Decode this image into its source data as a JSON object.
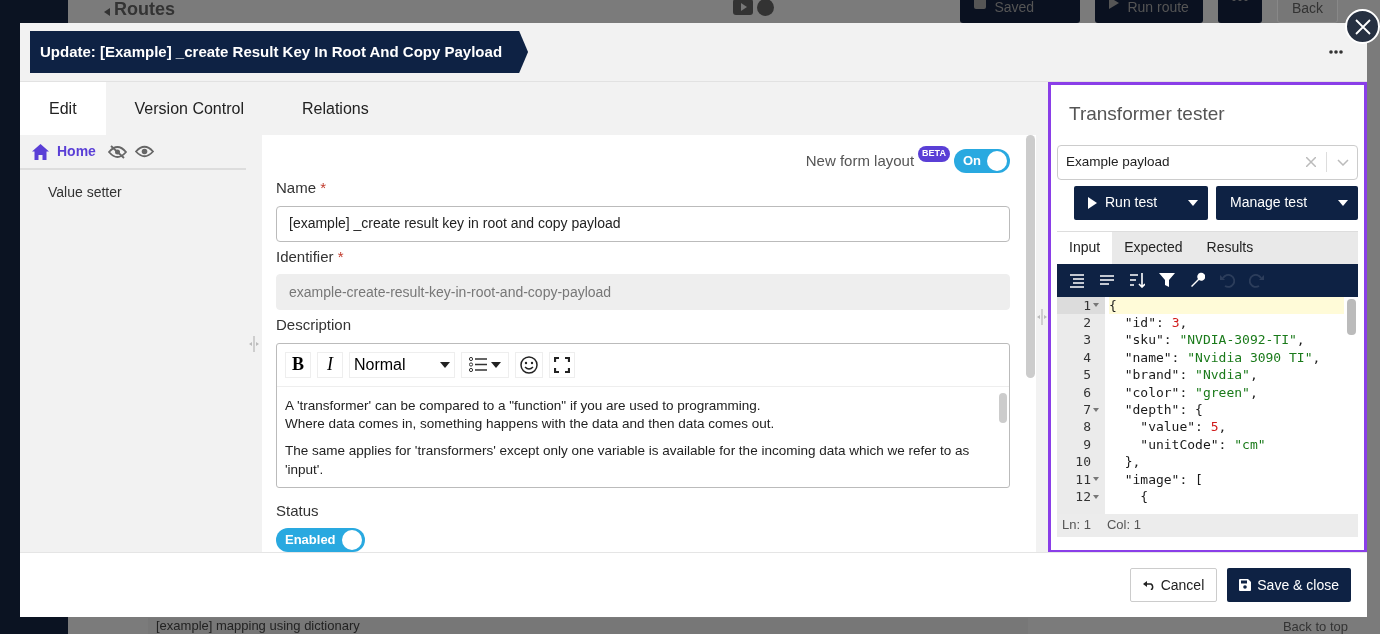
{
  "background": {
    "breadcrumb": "Routes",
    "buttons": [
      {
        "kind": "save",
        "label": "Saved"
      },
      {
        "kind": "run",
        "label": "Run route"
      },
      {
        "kind": "more"
      },
      {
        "kind": "back",
        "label": "Back"
      }
    ],
    "bottom_field": "[example] mapping using dictionary",
    "back_to_top": "Back to top"
  },
  "modal": {
    "title": "Update: [Example] _create Result Key In Root And Copy Payload",
    "tabs": [
      {
        "label": "Edit",
        "selected": true
      },
      {
        "label": "Version Control",
        "selected": false
      },
      {
        "label": "Relations",
        "selected": false
      }
    ],
    "sidebar": {
      "home": "Home",
      "items": [
        {
          "label": "Value setter"
        }
      ]
    },
    "form": {
      "layout_switch": {
        "label": "New form layout",
        "badge": "BETA",
        "state_label": "On",
        "on": true
      },
      "fields": [
        {
          "kind": "text",
          "label": "Name",
          "required_mark": "*",
          "value": "[example] _create result key in root and copy payload",
          "disabled": false
        },
        {
          "kind": "text",
          "label": "Identifier",
          "required_mark": "*",
          "value": "example-create-result-key-in-root-and-copy-payload",
          "disabled": true
        }
      ],
      "description": {
        "label": "Description",
        "toolbar": [
          {
            "kind": "bold",
            "glyph": "B"
          },
          {
            "kind": "italic",
            "glyph": "I"
          },
          {
            "kind": "select",
            "label": "Normal"
          },
          {
            "kind": "list"
          },
          {
            "kind": "emoji"
          },
          {
            "kind": "fullscreen"
          }
        ],
        "paragraphs": [
          [
            "A 'transformer' can be compared to a \"function\" if you are used to programming.",
            "Where data comes in, something happens with the data and then data comes out."
          ],
          [
            "The same applies for 'transformers' except only one variable is available for the incoming data which we refer to as 'input'."
          ]
        ]
      },
      "status": {
        "label": "Status",
        "state_label": "Enabled",
        "on": true
      }
    },
    "tester": {
      "title": "Transformer tester",
      "payload_select": "Example payload",
      "buttons": [
        {
          "label": "Run test",
          "kind": "run"
        },
        {
          "label": "Manage test",
          "kind": "menu"
        }
      ],
      "tabs": [
        {
          "label": "Input",
          "selected": true
        },
        {
          "label": "Expected",
          "selected": false
        },
        {
          "label": "Results",
          "selected": false
        }
      ],
      "toolbar": [
        {
          "kind": "format",
          "disabled": false
        },
        {
          "kind": "compact",
          "disabled": false
        },
        {
          "kind": "sort",
          "disabled": false
        },
        {
          "kind": "filter",
          "disabled": false
        },
        {
          "kind": "repair",
          "disabled": false
        },
        {
          "kind": "undo",
          "disabled": true
        },
        {
          "kind": "redo",
          "disabled": true
        }
      ],
      "lines": [
        {
          "number": "1",
          "foldable": true,
          "current": true,
          "tokens": [
            {
              "kind": "punct",
              "text": "{"
            }
          ]
        },
        {
          "number": "2",
          "foldable": false,
          "current": false,
          "tokens": [
            {
              "kind": "key",
              "text": "  \"id\": "
            },
            {
              "kind": "number",
              "text": "3"
            },
            {
              "kind": "punct",
              "text": ","
            }
          ]
        },
        {
          "number": "3",
          "foldable": false,
          "current": false,
          "tokens": [
            {
              "kind": "key",
              "text": "  \"sku\": "
            },
            {
              "kind": "string",
              "text": "\"NVDIA-3092-TI\""
            },
            {
              "kind": "punct",
              "text": ","
            }
          ]
        },
        {
          "number": "4",
          "foldable": false,
          "current": false,
          "tokens": [
            {
              "kind": "key",
              "text": "  \"name\": "
            },
            {
              "kind": "string",
              "text": "\"Nvidia 3090 TI\""
            },
            {
              "kind": "punct",
              "text": ","
            }
          ]
        },
        {
          "number": "5",
          "foldable": false,
          "current": false,
          "tokens": [
            {
              "kind": "key",
              "text": "  \"brand\": "
            },
            {
              "kind": "string",
              "text": "\"Nvdia\""
            },
            {
              "kind": "punct",
              "text": ","
            }
          ]
        },
        {
          "number": "6",
          "foldable": false,
          "current": false,
          "tokens": [
            {
              "kind": "key",
              "text": "  \"color\": "
            },
            {
              "kind": "string",
              "text": "\"green\""
            },
            {
              "kind": "punct",
              "text": ","
            }
          ]
        },
        {
          "number": "7",
          "foldable": true,
          "current": false,
          "tokens": [
            {
              "kind": "key",
              "text": "  \"depth\": {"
            }
          ]
        },
        {
          "number": "8",
          "foldable": false,
          "current": false,
          "tokens": [
            {
              "kind": "key",
              "text": "    \"value\": "
            },
            {
              "kind": "number",
              "text": "5"
            },
            {
              "kind": "punct",
              "text": ","
            }
          ]
        },
        {
          "number": "9",
          "foldable": false,
          "current": false,
          "tokens": [
            {
              "kind": "key",
              "text": "    \"unitCode\": "
            },
            {
              "kind": "string",
              "text": "\"cm\""
            }
          ]
        },
        {
          "number": "10",
          "foldable": false,
          "current": false,
          "tokens": [
            {
              "kind": "punct",
              "text": "  },"
            }
          ]
        },
        {
          "number": "11",
          "foldable": true,
          "current": false,
          "tokens": [
            {
              "kind": "key",
              "text": "  \"image\": ["
            }
          ]
        },
        {
          "number": "12",
          "foldable": true,
          "current": false,
          "tokens": [
            {
              "kind": "punct",
              "text": "    {"
            }
          ]
        }
      ],
      "status": {
        "line": "Ln: 1",
        "column": "Col: 1"
      }
    },
    "footer": {
      "buttons": [
        {
          "label": "Cancel",
          "kind": "secondary"
        },
        {
          "label": "Save & close",
          "kind": "primary"
        }
      ]
    }
  }
}
